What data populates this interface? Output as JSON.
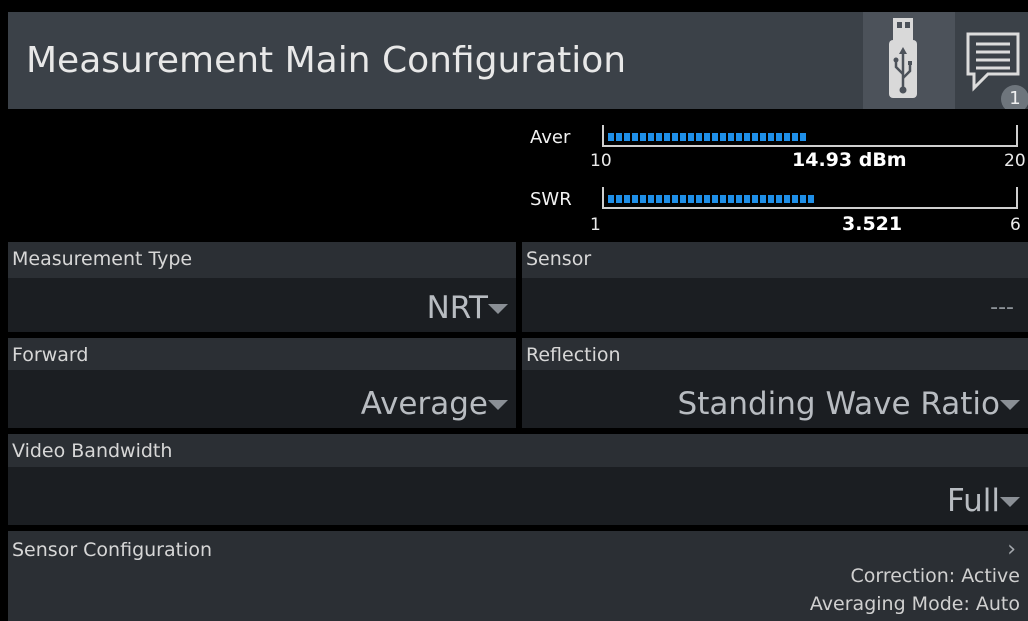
{
  "header": {
    "title": "Measurement Main Configuration",
    "usb_icon": "usb-icon",
    "messages_icon": "message-icon",
    "messages_count": "1"
  },
  "meters": {
    "aver": {
      "label": "Aver",
      "min": "10",
      "max": "20",
      "value_text": "14.93 dBm",
      "fill_fraction": 0.49
    },
    "swr": {
      "label": "SWR",
      "min": "1",
      "max": "6",
      "value_text": "3.521",
      "fill_fraction": 0.51
    },
    "bar_color": "#1f8fe8"
  },
  "fields": {
    "measurement_type": {
      "label": "Measurement Type",
      "value": "NRT"
    },
    "sensor": {
      "label": "Sensor",
      "value": "---"
    },
    "forward": {
      "label": "Forward",
      "value": "Average"
    },
    "reflection": {
      "label": "Reflection",
      "value": "Standing Wave Ratio"
    },
    "video_bandwidth": {
      "label": "Video Bandwidth",
      "value": "Full"
    }
  },
  "sensor_configuration": {
    "label": "Sensor Configuration",
    "correction": "Correction: Active",
    "averaging_mode": "Averaging Mode: Auto",
    "chevron_icon": "chevron-right-icon"
  }
}
